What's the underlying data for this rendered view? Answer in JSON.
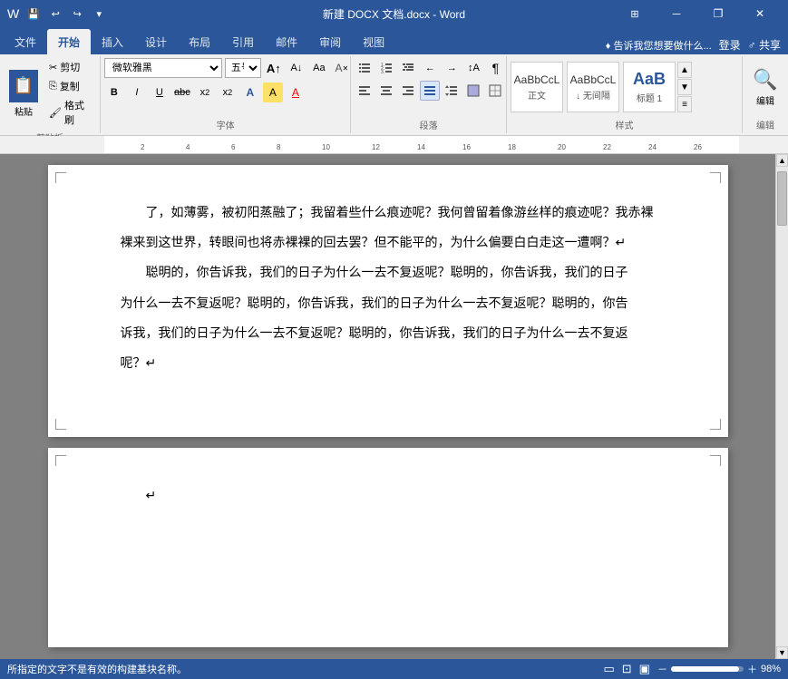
{
  "titlebar": {
    "title": "新建 DOCX 文档.docx - Word",
    "minimize": "－",
    "restore": "❐",
    "close": "✕",
    "window_icon": "⊞"
  },
  "quick_access": {
    "save": "💾",
    "undo": "↩",
    "redo": "↪",
    "more": "▾"
  },
  "tabs": [
    {
      "id": "file",
      "label": "文件"
    },
    {
      "id": "home",
      "label": "开始",
      "active": true
    },
    {
      "id": "insert",
      "label": "插入"
    },
    {
      "id": "design",
      "label": "设计"
    },
    {
      "id": "layout",
      "label": "布局"
    },
    {
      "id": "references",
      "label": "引用"
    },
    {
      "id": "mailings",
      "label": "邮件"
    },
    {
      "id": "review",
      "label": "审阅"
    },
    {
      "id": "view",
      "label": "视图"
    }
  ],
  "ribbon_right": {
    "tell_me": "♦ 告诉我您想要做什么...",
    "login": "登录",
    "share": "♂ 共享"
  },
  "groups": {
    "clipboard": {
      "label": "剪贴板",
      "paste_label": "粘贴",
      "cut_label": "剪切",
      "copy_label": "复制",
      "format_painter_label": "格式刷"
    },
    "font": {
      "label": "字体",
      "font_name": "微软雅黑",
      "font_size": "五号",
      "bold": "B",
      "italic": "I",
      "underline": "U",
      "strikethrough": "abc",
      "subscript": "x₂",
      "superscript": "x²",
      "clear_format": "A",
      "font_color": "A",
      "highlight": "A",
      "text_effects": "A",
      "increase_font": "A↑",
      "decrease_font": "A↓",
      "change_case": "Aa"
    },
    "paragraph": {
      "label": "段落",
      "bullets": "≡",
      "numbering": "≡",
      "multilevel": "≡",
      "decrease_indent": "←",
      "increase_indent": "→",
      "sort": "↕",
      "show_marks": "¶",
      "align_left": "≡",
      "center": "≡",
      "align_right": "≡",
      "justify": "≡",
      "line_spacing": "≡",
      "shading": "□",
      "borders": "□"
    },
    "styles": {
      "label": "样式",
      "items": [
        {
          "name": "正文",
          "preview": "AaBbCcL"
        },
        {
          "name": "↓ 无间隔",
          "preview": "AaBbCcL"
        },
        {
          "name": "标题 1",
          "preview": "AaB"
        }
      ]
    },
    "editing": {
      "label": "编辑",
      "search_icon": "🔍"
    }
  },
  "document": {
    "page1_lines": [
      "了，如薄雾，被初阳蒸融了；我留着些什么痕迹呢？我何曾留着像游丝样的痕迹呢？我赤裸",
      "裸来到这世界，转眼间也将赤裸裸的回去罢？但不能平的，为什么偏要白白走这一遭啊？",
      "",
      "聪明的，你告诉我，我们的日子为什么一去不复返呢？聪明的，你告诉我，我们的日子",
      "为什么一去不复返呢？聪明的，你告诉我，我们的日子为什么一去不复返呢？聪明的，你告",
      "诉我，我们的日子为什么一去不复返呢？聪明的，你告诉我，我们的日子为什么一去不复返",
      "呢？"
    ],
    "page2_lines": [
      ""
    ]
  },
  "statusbar": {
    "page_info": "所指定的文字不是有效的构建基块名称。",
    "page_count": "",
    "zoom_level": "98%",
    "view_icons": [
      "□",
      "□",
      "□"
    ]
  }
}
